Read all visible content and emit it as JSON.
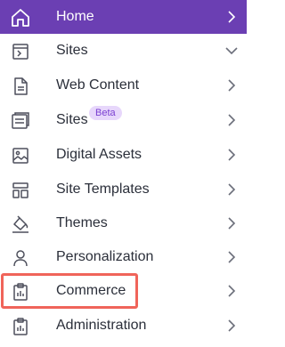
{
  "colors": {
    "active_bg": "#6b3fb3",
    "active_text": "#ffffff",
    "text": "#2b2f3a",
    "icon": "#4d4f5c",
    "chevron": "#6b6e7a",
    "badge_bg": "#e7d7fb",
    "badge_text": "#7a3fd1",
    "highlight": "#f0645a"
  },
  "menu": {
    "items": [
      {
        "label": "Home",
        "icon": "home-icon",
        "chevron": "right",
        "active": true
      },
      {
        "label": "Sites",
        "icon": "site-terminal-icon",
        "chevron": "down"
      },
      {
        "label": "Web Content",
        "icon": "document-icon",
        "chevron": "right"
      },
      {
        "label": "Sites",
        "icon": "stacked-pages-icon",
        "chevron": "right",
        "badge": "Beta"
      },
      {
        "label": "Digital Assets",
        "icon": "image-icon",
        "chevron": "right"
      },
      {
        "label": "Site Templates",
        "icon": "layout-template-icon",
        "chevron": "right"
      },
      {
        "label": "Themes",
        "icon": "paint-bucket-icon",
        "chevron": "right"
      },
      {
        "label": "Personalization",
        "icon": "user-icon",
        "chevron": "right"
      },
      {
        "label": "Commerce",
        "icon": "clipboard-chart-icon",
        "chevron": "right",
        "highlighted": true
      },
      {
        "label": "Administration",
        "icon": "clipboard-chart-icon",
        "chevron": "right"
      }
    ]
  }
}
